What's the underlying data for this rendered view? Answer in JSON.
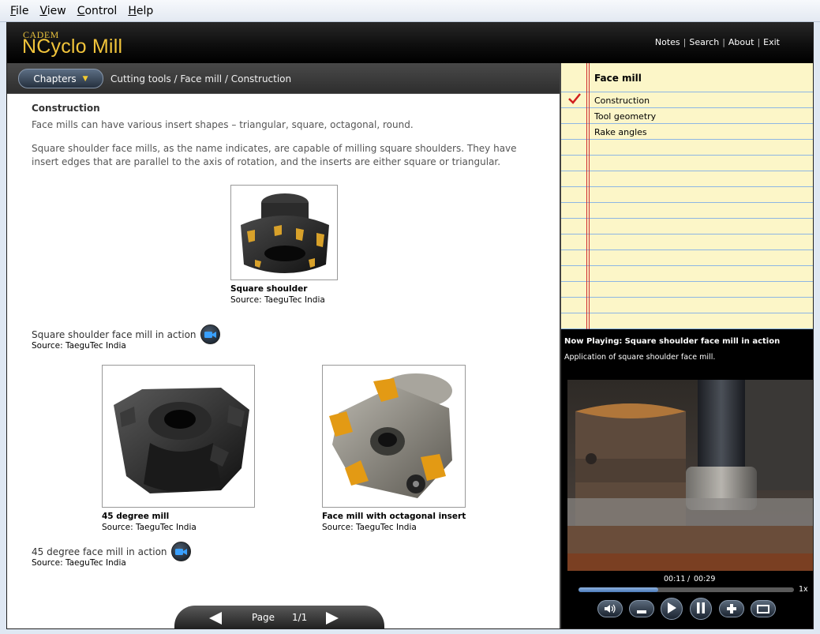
{
  "menubar": {
    "items": [
      {
        "key": "F",
        "rest": "ile"
      },
      {
        "key": "V",
        "rest": "iew"
      },
      {
        "key": "C",
        "rest": "ontrol"
      },
      {
        "key": "H",
        "rest": "elp"
      }
    ]
  },
  "app": {
    "logo_small": "CADEM",
    "logo_big": "NCyclo Mill",
    "top_links": [
      "Notes",
      "Search",
      "About",
      "Exit"
    ],
    "top_link_sep": "|"
  },
  "breadcrumb": {
    "chapters_label": "Chapters",
    "path": "Cutting tools / Face mill / Construction"
  },
  "content": {
    "title": "Construction",
    "para1": "Face mills can have various insert shapes – triangular, square, octagonal, round.",
    "para2": "Square shoulder face mills, as the name indicates, are capable of milling square shoulders.  They have insert edges that are parallel to the axis of rotation, and the inserts are either square or triangular.",
    "figures": [
      {
        "title": "Square shoulder",
        "source": "Source: TaeguTec India"
      },
      {
        "title": "45 degree mill",
        "source": "Source: TaeguTec India"
      },
      {
        "title": "Face mill with octagonal insert",
        "source": "Source: TaeguTec India"
      }
    ],
    "actions": [
      {
        "text": "Square shoulder face mill in action",
        "source": "Source: TaeguTec India"
      },
      {
        "text": "45 degree face mill in action",
        "source": "Source: TaeguTec India"
      }
    ]
  },
  "pager": {
    "label": "Page",
    "value": "1/1"
  },
  "notepad": {
    "title": "Face mill",
    "items": [
      "Construction",
      "Tool geometry",
      "Rake angles"
    ],
    "checked_index": 0
  },
  "player": {
    "now_playing_label": "Now Playing:",
    "now_playing_title": "Square shoulder face mill in action",
    "description": "Application of square shoulder face mill.",
    "current_time": "00:11",
    "time_sep": "/",
    "duration": "00:29",
    "progress": 0.37,
    "speed": "1x"
  },
  "colors": {
    "accent": "#f1c43b",
    "notepad_bg": "#fcf6c8",
    "notepad_line": "#8db6e4",
    "margin_red": "#cf2b2b"
  },
  "icons": [
    "video-camera-icon",
    "check-icon",
    "prev-page-icon",
    "next-page-icon",
    "volume-icon",
    "minus-icon",
    "play-icon",
    "pause-icon",
    "plus-icon",
    "fullscreen-icon"
  ]
}
